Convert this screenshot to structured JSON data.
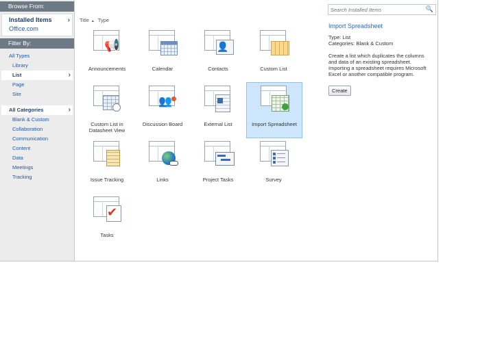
{
  "sidebar": {
    "browse_header": "Browse From:",
    "browse_items": [
      "Installed Items",
      "Office.com"
    ],
    "filter_header": "Filter By:",
    "types": [
      {
        "label": "All Types"
      },
      {
        "label": "Library"
      },
      {
        "label": "List"
      },
      {
        "label": "Page"
      },
      {
        "label": "Site"
      }
    ],
    "categories": [
      {
        "label": "All Categories"
      },
      {
        "label": "Blank & Custom"
      },
      {
        "label": "Collaboration"
      },
      {
        "label": "Communication"
      },
      {
        "label": "Content"
      },
      {
        "label": "Data"
      },
      {
        "label": "Meetings"
      },
      {
        "label": "Tracking"
      }
    ],
    "chevron": "›"
  },
  "sort": {
    "title": "Title",
    "arrow": "▲",
    "type": "Type"
  },
  "tiles": [
    {
      "label": "Announcements",
      "icon": "megaphone-icon"
    },
    {
      "label": "Calendar",
      "icon": "calendar-icon"
    },
    {
      "label": "Contacts",
      "icon": "contact-card-icon"
    },
    {
      "label": "Custom List",
      "icon": "custom-list-icon"
    },
    {
      "label": "Custom List in Datasheet View",
      "icon": "datasheet-icon"
    },
    {
      "label": "Discussion Board",
      "icon": "discussion-icon"
    },
    {
      "label": "External List",
      "icon": "external-list-icon"
    },
    {
      "label": "Import Spreadsheet",
      "icon": "spreadsheet-icon"
    },
    {
      "label": "Issue Tracking",
      "icon": "issue-tracking-icon"
    },
    {
      "label": "Links",
      "icon": "globe-link-icon"
    },
    {
      "label": "Project Tasks",
      "icon": "gantt-icon"
    },
    {
      "label": "Survey",
      "icon": "survey-icon"
    },
    {
      "label": "Tasks",
      "icon": "checkmark-icon"
    }
  ],
  "search": {
    "placeholder": "Search Installed Items",
    "icon": "search-icon"
  },
  "detail": {
    "title": "Import Spreadsheet",
    "type_line": "Type: List",
    "categories_line": "Categories: Blank & Custom",
    "description": "Create a list which duplicates the columns and data of an existing spreadsheet.  Importing a spreadsheet requires Microsoft Excel or another compatible program.",
    "create_label": "Create"
  },
  "colors": {
    "selection": "#cde6fb",
    "accent": "#2a6ab8",
    "header": "#6d7a86"
  }
}
